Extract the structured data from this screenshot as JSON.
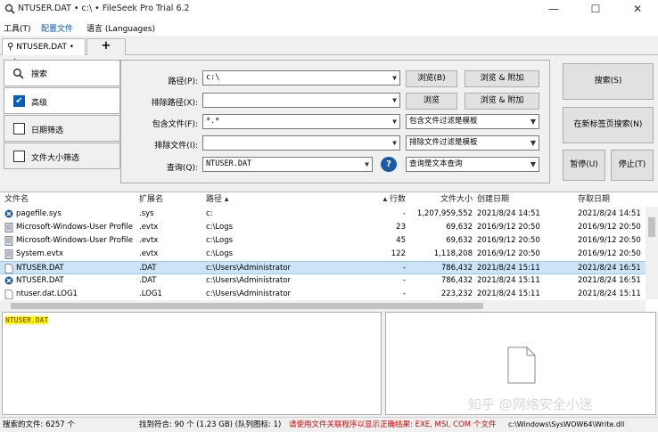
{
  "window": {
    "title": "NTUSER.DAT • c:\\ • FileSeek Pro Trial 6.2",
    "min": "—",
    "max": "☐",
    "close": "✕"
  },
  "menu": [
    "工具(T)",
    "配置文件",
    "语言 (Languages)"
  ],
  "tabs": {
    "active": "NTUSER.DAT • c:\\",
    "add": "+"
  },
  "side": {
    "search": "搜索",
    "advanced": "高级",
    "date_filter": "日期筛选",
    "size_filter": "文件大小筛选"
  },
  "form": {
    "path_label": "路径(P):",
    "path_value": "c:\\",
    "exclude_path_label": "排除路径(X):",
    "exclude_path_value": "",
    "include_files_label": "包含文件(F):",
    "include_files_value": "*.*",
    "exclude_files_label": "排除文件(I):",
    "exclude_files_value": "",
    "query_label": "查询(Q):",
    "query_value": "NTUSER.DAT",
    "browse1": "浏览(B)",
    "browse_append1": "浏览 & 附加",
    "browse2": "浏览",
    "browse_append2": "浏览 & 附加",
    "include_mode": "包含文件过滤是模板",
    "exclude_mode": "排除文件过滤是模板",
    "query_mode": "查询是文本查询",
    "help": "?"
  },
  "actions": {
    "search": "搜索(S)",
    "search_new_tab": "在新标签页搜索(N)",
    "pause": "暂停(U)",
    "stop": "停止(T)"
  },
  "grid": {
    "headers": [
      "文件名",
      "扩展名",
      "路径 ▴",
      "▴ 行数",
      "文件大小",
      "创建日期",
      "存取日期"
    ],
    "rows": [
      {
        "name": "pagefile.sys",
        "ext": ".sys",
        "path": "c:",
        "lines": "-",
        "size": "1,207,959,552",
        "created": "2021/8/24 14:51",
        "accessed": "2021/8/24 14:51",
        "icon": "error"
      },
      {
        "name": "Microsoft-Windows-User Profile S...",
        "ext": ".evtx",
        "path": "c:\\Logs",
        "lines": "23",
        "size": "69,632",
        "created": "2016/9/12 20:50",
        "accessed": "2016/9/12 20:50",
        "icon": "file"
      },
      {
        "name": "Microsoft-Windows-User Profile S...",
        "ext": ".evtx",
        "path": "c:\\Logs",
        "lines": "45",
        "size": "69,632",
        "created": "2016/9/12 20:50",
        "accessed": "2016/9/12 20:50",
        "icon": "file"
      },
      {
        "name": "System.evtx",
        "ext": ".evtx",
        "path": "c:\\Logs",
        "lines": "122",
        "size": "1,118,208",
        "created": "2016/9/12 20:50",
        "accessed": "2016/9/12 20:50",
        "icon": "file"
      },
      {
        "name": "NTUSER.DAT",
        "ext": ".DAT",
        "path": "c:\\Users\\Administrator",
        "lines": "-",
        "size": "786,432",
        "created": "2021/8/24 15:11",
        "accessed": "2021/8/24 16:51",
        "icon": "blank"
      },
      {
        "name": "NTUSER.DAT",
        "ext": ".DAT",
        "path": "c:\\Users\\Administrator",
        "lines": "-",
        "size": "786,432",
        "created": "2021/8/24 15:11",
        "accessed": "2021/8/24 16:51",
        "icon": "error"
      },
      {
        "name": "ntuser.dat.LOG1",
        "ext": ".LOG1",
        "path": "c:\\Users\\Administrator",
        "lines": "-",
        "size": "223,232",
        "created": "2021/8/24 15:11",
        "accessed": "2021/8/24 15:11",
        "icon": "blank"
      }
    ]
  },
  "preview": {
    "highlight": "NTUSER.DAT",
    "watermark": "知乎 @网络安全小迷"
  },
  "status": {
    "searched": "搜索的文件: 6257 个",
    "matched": "找到符合: 90 个 (1.23 GB) (队列图标: 1)",
    "warning": "请使用文件关联程序以显示正确结果: EXE, MSI, COM 个文件",
    "path": "c:\\Windows\\SysWOW64\\Write.dll"
  },
  "colors": {
    "accent": "#0060c0",
    "warning": "#e00000",
    "highlight": "#ffff00",
    "selection": "#cce4f7"
  }
}
